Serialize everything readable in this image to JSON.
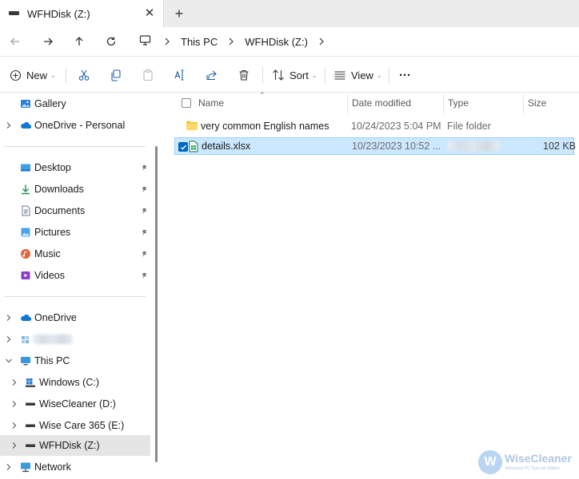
{
  "tab": {
    "title": "WFHDisk (Z:)",
    "close": "✕",
    "new": "+"
  },
  "address": {
    "crumbs": [
      "This PC",
      "WFHDisk (Z:)"
    ]
  },
  "toolbar": {
    "new_label": "New",
    "sort_label": "Sort",
    "view_label": "View",
    "more": "···"
  },
  "sidebar": {
    "top": [
      {
        "label": "Gallery"
      },
      {
        "label": "OneDrive - Personal"
      }
    ],
    "quick": [
      {
        "label": "Desktop"
      },
      {
        "label": "Downloads"
      },
      {
        "label": "Documents"
      },
      {
        "label": "Pictures"
      },
      {
        "label": "Music"
      },
      {
        "label": "Videos"
      }
    ],
    "tree": {
      "onedrive": "OneDrive",
      "thispc": "This PC",
      "drives": [
        {
          "label": "Windows (C:)"
        },
        {
          "label": "WiseCleaner (D:)"
        },
        {
          "label": "Wise Care 365 (E:)"
        },
        {
          "label": "WFHDisk (Z:)"
        }
      ],
      "network": "Network"
    }
  },
  "columns": {
    "name": "Name",
    "modified": "Date modified",
    "type": "Type",
    "size": "Size"
  },
  "files": [
    {
      "name": "very common English names",
      "modified": "10/24/2023 5:04 PM",
      "type": "File folder",
      "size": ""
    },
    {
      "name": "details.xlsx",
      "modified": "10/23/2023 10:52 ...",
      "type": "",
      "size": "102 KB"
    }
  ],
  "watermark": {
    "title": "WiseCleaner",
    "subtitle": "Advanced PC Tune-up Utilities"
  },
  "colors": {
    "accent": "#0067c0",
    "selection": "#cce8ff",
    "selection_border": "#99d1ff",
    "folder": "#f7c948",
    "excel": "#1d7044"
  }
}
